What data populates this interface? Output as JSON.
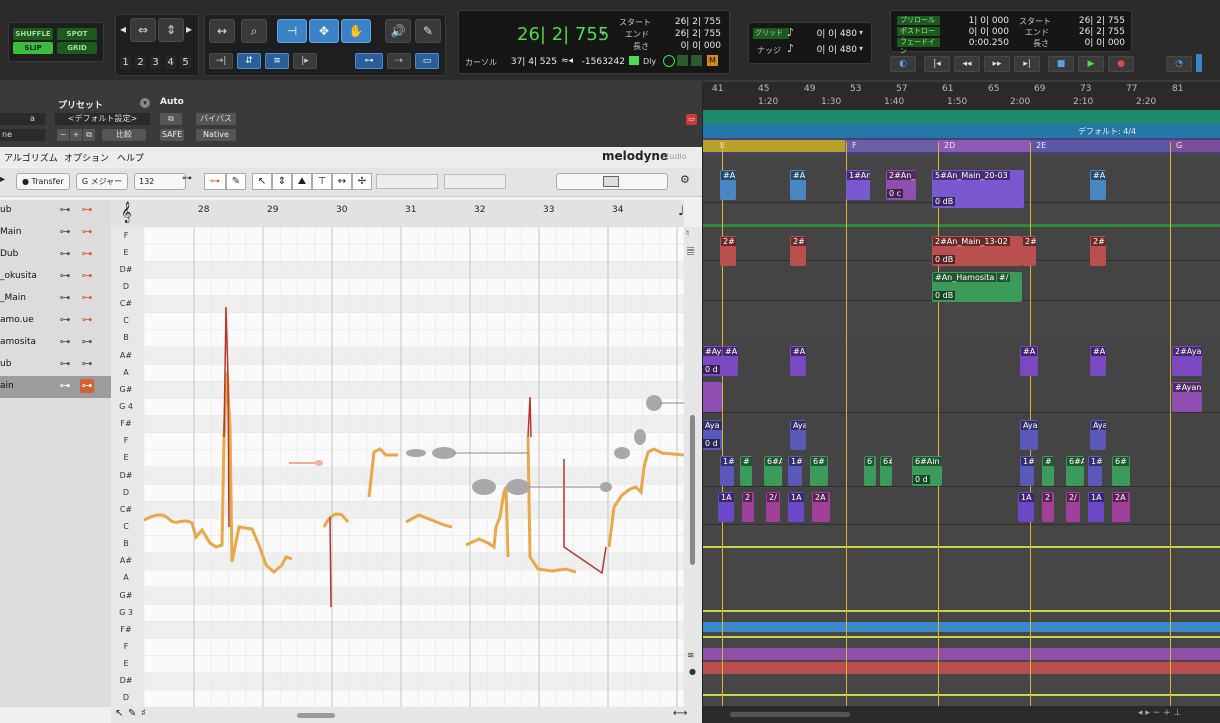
{
  "modes": {
    "shuffle": "SHUFFLE",
    "spot": "SPOT",
    "slip": "SLIP",
    "grid": "GRID"
  },
  "zoom_presets": [
    "1",
    "2",
    "3",
    "4",
    "5"
  ],
  "main_counter": {
    "value": "26| 2| 755",
    "start_label": "スタート",
    "end_label": "エンド",
    "length_label": "長さ",
    "start": "26| 2| 755",
    "end": "26| 2| 755",
    "length": "0| 0| 000",
    "cursor_label": "カーソル",
    "cursor": "37| 4| 525",
    "cursor_sample": "-1563242",
    "dly": "Dly"
  },
  "grid_nudge": {
    "grid_label": "グリッド",
    "grid_value": "0| 0| 480",
    "nudge_label": "ナッジ",
    "nudge_value": "0| 0| 480"
  },
  "preroll": {
    "preroll_label": "プリロール",
    "preroll": "1| 0| 000",
    "postroll_label": "ポストロール",
    "postroll": "0| 0| 000",
    "fadein_label": "フェードイン",
    "fadein": "0:00.250",
    "start_label": "スタート",
    "start": "26| 2| 755",
    "end_label": "エンド",
    "end": "26| 2| 755",
    "length_label": "長さ",
    "length": "0| 0| 000"
  },
  "ruler": {
    "bars": [
      "41",
      "45",
      "49",
      "53",
      "57",
      "61",
      "65",
      "69",
      "73",
      "77",
      "81"
    ],
    "times": [
      "1:20",
      "1:30",
      "1:40",
      "1:50",
      "2:00",
      "2:10",
      "2:20"
    ],
    "meter": "デフォルト: 4/4",
    "markers": [
      "E",
      "F",
      "2D",
      "2E",
      "G"
    ]
  },
  "clips": {
    "a": "#A",
    "b": "#A",
    "c": "1#An_",
    "d": "2#An_",
    "e": "5#An_Main_20-03",
    "f": "#A",
    "g": "2#",
    "h": "2#",
    "i": "2#An_Main_13-02",
    "j": "2#",
    "k": "2#",
    "l": "#An_Hamosita",
    "m": "#/",
    "n": "#Ayan",
    "o": "#A",
    "p": "#A",
    "q": "#A",
    "r": "#A",
    "s": "2#Ayan",
    "t": "#Ayan",
    "u": "Aya",
    "v": "Aya",
    "w": "Aya",
    "x": "Aya",
    "y1": "1#",
    "y2": "#",
    "y3": "6#A",
    "y4": "1#",
    "y5": "6#",
    "y6": "6",
    "y7": "6#",
    "y8": "6#Ain",
    "y9": "1#",
    "y10": "#",
    "y11": "6#A",
    "y12": "1#",
    "y13": "6#",
    "z1": "1A",
    "z2": "2",
    "z3": "2/",
    "z4": "1A",
    "z5": "2A",
    "z6": "1A",
    "z7": "2",
    "z8": "2/",
    "z9": "1A",
    "z10": "2A",
    "db": "0 dB",
    "db_short": "0 c",
    "db_d": "0 d"
  },
  "melodyne": {
    "preset_label": "プリセット",
    "auto_label": "Auto",
    "preset_value": "<デフォルト設定>",
    "bypass": "バイパス",
    "compare": "比較",
    "safe": "SAFE",
    "native": "Native",
    "a_label": "a",
    "ne_label": "ne",
    "menus": [
      "アルゴリズム",
      "オプション",
      "ヘルプ"
    ],
    "brand": "melodyne",
    "brand_sub": "studio",
    "transfer": "Transfer",
    "key": "G メジャー",
    "tempo": "132",
    "tracks": [
      "ub",
      "Main",
      "Dub",
      "_okusita",
      "_Main",
      "amo.ue",
      "amosita",
      "ub",
      "ain"
    ],
    "bars": [
      "28",
      "29",
      "30",
      "31",
      "32",
      "33",
      "34"
    ],
    "keys": [
      "F",
      "E",
      "D#",
      "D",
      "C#",
      "C",
      "B",
      "A#",
      "A",
      "G#",
      "G 4",
      "F#",
      "F",
      "E",
      "D#",
      "D",
      "C#",
      "C",
      "B",
      "A#",
      "A",
      "G#",
      "G 3",
      "F#",
      "F",
      "E",
      "D#",
      "D"
    ]
  }
}
